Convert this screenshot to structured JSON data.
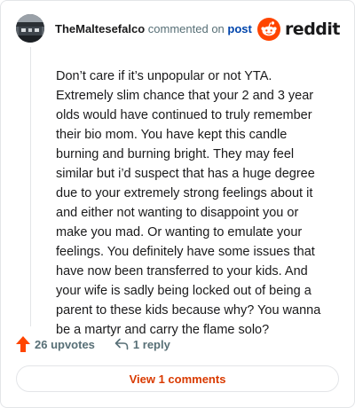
{
  "comment": {
    "author": "TheMaltesefalco",
    "action_text": "commented on",
    "link_text": "post",
    "body": "Don’t care if it’s unpopular or not YTA. Extremely slim chance that your 2 and 3 year olds would have continued to truly remember their bio mom. You have kept this candle burning and burning bright. They may feel similar but i’d suspect that has a huge degree due to your extremely strong feelings about it and either not wanting to disappoint you or make you mad. Or wanting to emulate your feelings. You definitely have some issues that have now been transferred to your kids. And your wife is sadly being locked out of being a parent to these kids because why? You wanna be a martyr and carry the flame solo?",
    "upvotes_label": "26 upvotes",
    "replies_label": "1 reply",
    "view_comments_label": "View 1 comments"
  },
  "brand": {
    "name": "reddit",
    "accent_color": "#ff4500",
    "link_color": "#0045ac",
    "button_text_color": "#d93a00"
  },
  "icons": {
    "upvote": "upvote-arrow-icon",
    "reply": "reply-arrow-icon",
    "logo": "reddit-snoo-icon"
  }
}
